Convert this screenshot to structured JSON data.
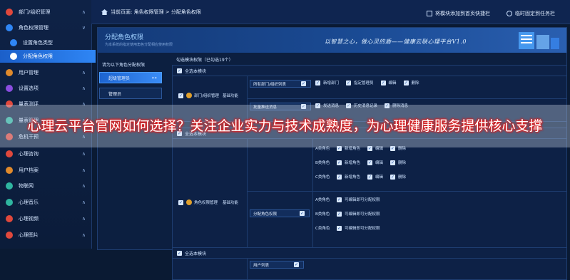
{
  "sidebar": {
    "items": [
      {
        "label": "部门/组织管理",
        "icon": "building-icon",
        "color": "#e0483c",
        "chevron": "∧"
      },
      {
        "label": "角色权限管理",
        "icon": "role-icon",
        "color": "#2f86f5",
        "chevron": "∨"
      },
      {
        "label": "设置角色类型",
        "icon": "person-icon",
        "color": "#2f86f5",
        "chevron": ""
      },
      {
        "label": "分配角色权限",
        "icon": "share-icon",
        "color": "#ffffff",
        "chevron": ""
      },
      {
        "label": "用户管理",
        "icon": "user-icon",
        "color": "#e08a2c",
        "chevron": "∧"
      },
      {
        "label": "设置选项",
        "icon": "settings-icon",
        "color": "#8a4de0",
        "chevron": "∧"
      },
      {
        "label": "量表测评",
        "icon": "scale-icon",
        "color": "#e0483c",
        "chevron": "∧"
      },
      {
        "label": "量表管理",
        "icon": "list-icon",
        "color": "#2fb5a0",
        "chevron": "∧"
      },
      {
        "label": "危机干预",
        "icon": "alert-icon",
        "color": "#e0483c",
        "chevron": "∧"
      },
      {
        "label": "心理咨询",
        "icon": "chat-icon",
        "color": "#e0483c",
        "chevron": "∧"
      },
      {
        "label": "用户档案",
        "icon": "file-icon",
        "color": "#e08a2c",
        "chevron": "∧"
      },
      {
        "label": "物联网",
        "icon": "iot-icon",
        "color": "#2fb5a0",
        "chevron": "∧"
      },
      {
        "label": "心理音乐",
        "icon": "music-icon",
        "color": "#2fb5a0",
        "chevron": "∧"
      },
      {
        "label": "心理视频",
        "icon": "video-icon",
        "color": "#e0483c",
        "chevron": "∧"
      },
      {
        "label": "心理图片",
        "icon": "image-icon",
        "color": "#e0483c",
        "chevron": "∧"
      }
    ]
  },
  "topbar": {
    "home_icon": "home-icon",
    "breadcrumb": "当前页面: 角色权限管理 > 分配角色权限",
    "btn_add_home": "将模块添加到首页快捷栏",
    "btn_pin": "临时固定到任务栏"
  },
  "banner": {
    "title": "分配角色权限",
    "subtitle": "为本系统的指定使用角色分配相应使用权限",
    "slogan": "以智慧之心，做心灵的盾——健康云联心理平台V1.0"
  },
  "roles": {
    "title": "请为以下角色分配权限",
    "items": [
      {
        "label": "超级管理员",
        "active": true
      },
      {
        "label": "管理员",
        "active": false
      }
    ]
  },
  "grid": {
    "selected_count": "勾选模块权限（已勾选19个）",
    "select_all": "全选本模块",
    "module1": {
      "name": "部门/组织管理",
      "category": "基础功能",
      "row1_pill": "所有部门/组织列表",
      "row1_perms": [
        "新增部门",
        "指定管理员",
        "编辑",
        "删除"
      ],
      "row2_pill": "批量推送消息",
      "row2_perms": [
        "发送消息",
        "历史消息记录",
        "删除消息"
      ]
    },
    "module2": {
      "name": "角色权限管理",
      "category": "基础功能",
      "partial_label": "全选本模块",
      "rows": [
        {
          "label": "A类角色",
          "perms": [
            "新增角色",
            "编辑",
            "删除"
          ]
        },
        {
          "label": "B类角色",
          "perms": [
            "新增角色",
            "编辑",
            "删除"
          ]
        },
        {
          "label": "C类角色",
          "perms": [
            "新增角色",
            "编辑",
            "删除"
          ]
        }
      ],
      "pill2": "分配角色权限",
      "rows2": [
        {
          "label": "A类角色",
          "perms": [
            "可编辑即可分配权限"
          ]
        },
        {
          "label": "B类角色",
          "perms": [
            "可编辑即可分配权限"
          ]
        },
        {
          "label": "C类角色",
          "perms": [
            "可编辑即可分配权限"
          ]
        }
      ]
    },
    "module3": {
      "pill": "用户列表"
    }
  },
  "overlay": {
    "text": "心理云平台官网如何选择？关注企业实力与技术成熟度，为心理健康服务提供核心支撑"
  },
  "colors": {
    "accent": "#2f86f5",
    "bg": "#0a1a33",
    "panel": "#0c1f40"
  }
}
